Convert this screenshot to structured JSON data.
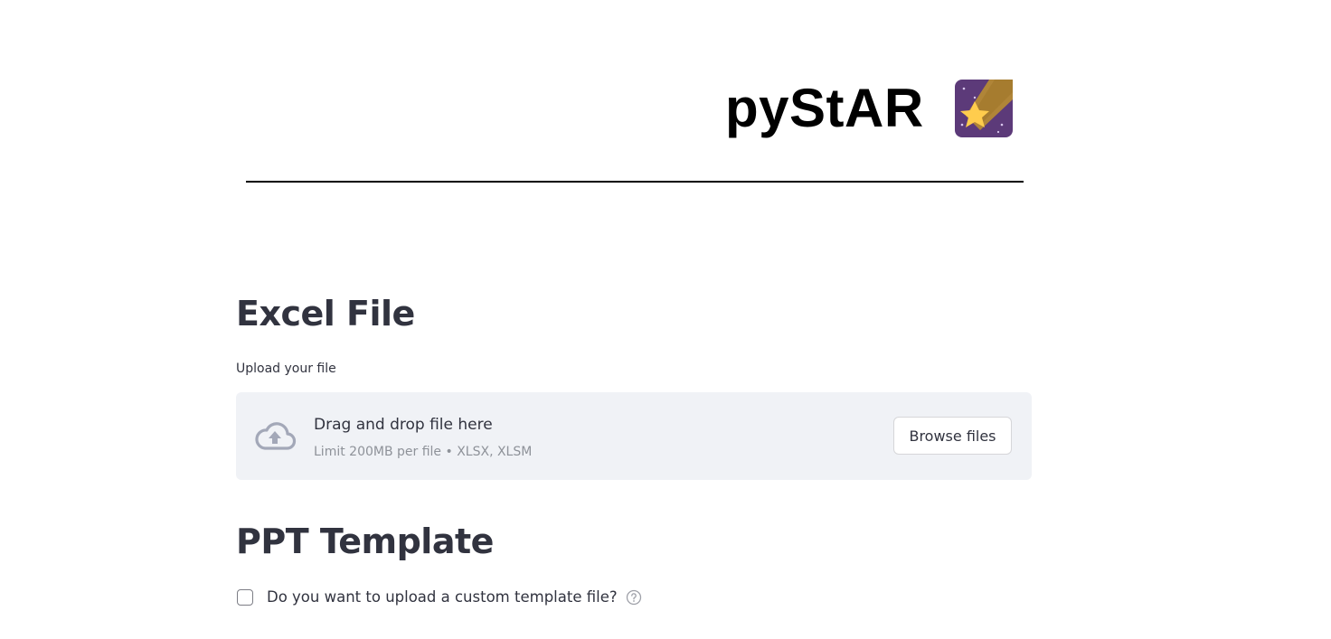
{
  "header": {
    "title": "pyStAR",
    "logo_icon": "shooting-star-icon"
  },
  "excel_section": {
    "heading": "Excel File",
    "upload_label": "Upload your file",
    "dropzone": {
      "icon": "cloud-upload-icon",
      "instruction": "Drag and drop file here",
      "limit_text": "Limit 200MB per file • XLSX, XLSM",
      "browse_label": "Browse files"
    }
  },
  "ppt_section": {
    "heading": "PPT Template",
    "custom_template_checkbox": {
      "label": "Do you want to upload a custom template file?",
      "checked": false,
      "help_icon": "help-circle-icon"
    }
  },
  "colors": {
    "text": "#31333f",
    "dropzone_bg": "#f0f2f6",
    "cloud_icon": "#a3a8b8",
    "logo_bg": "#5c3a79",
    "logo_star": "#ffcc4d",
    "logo_trail": "#b08538"
  }
}
